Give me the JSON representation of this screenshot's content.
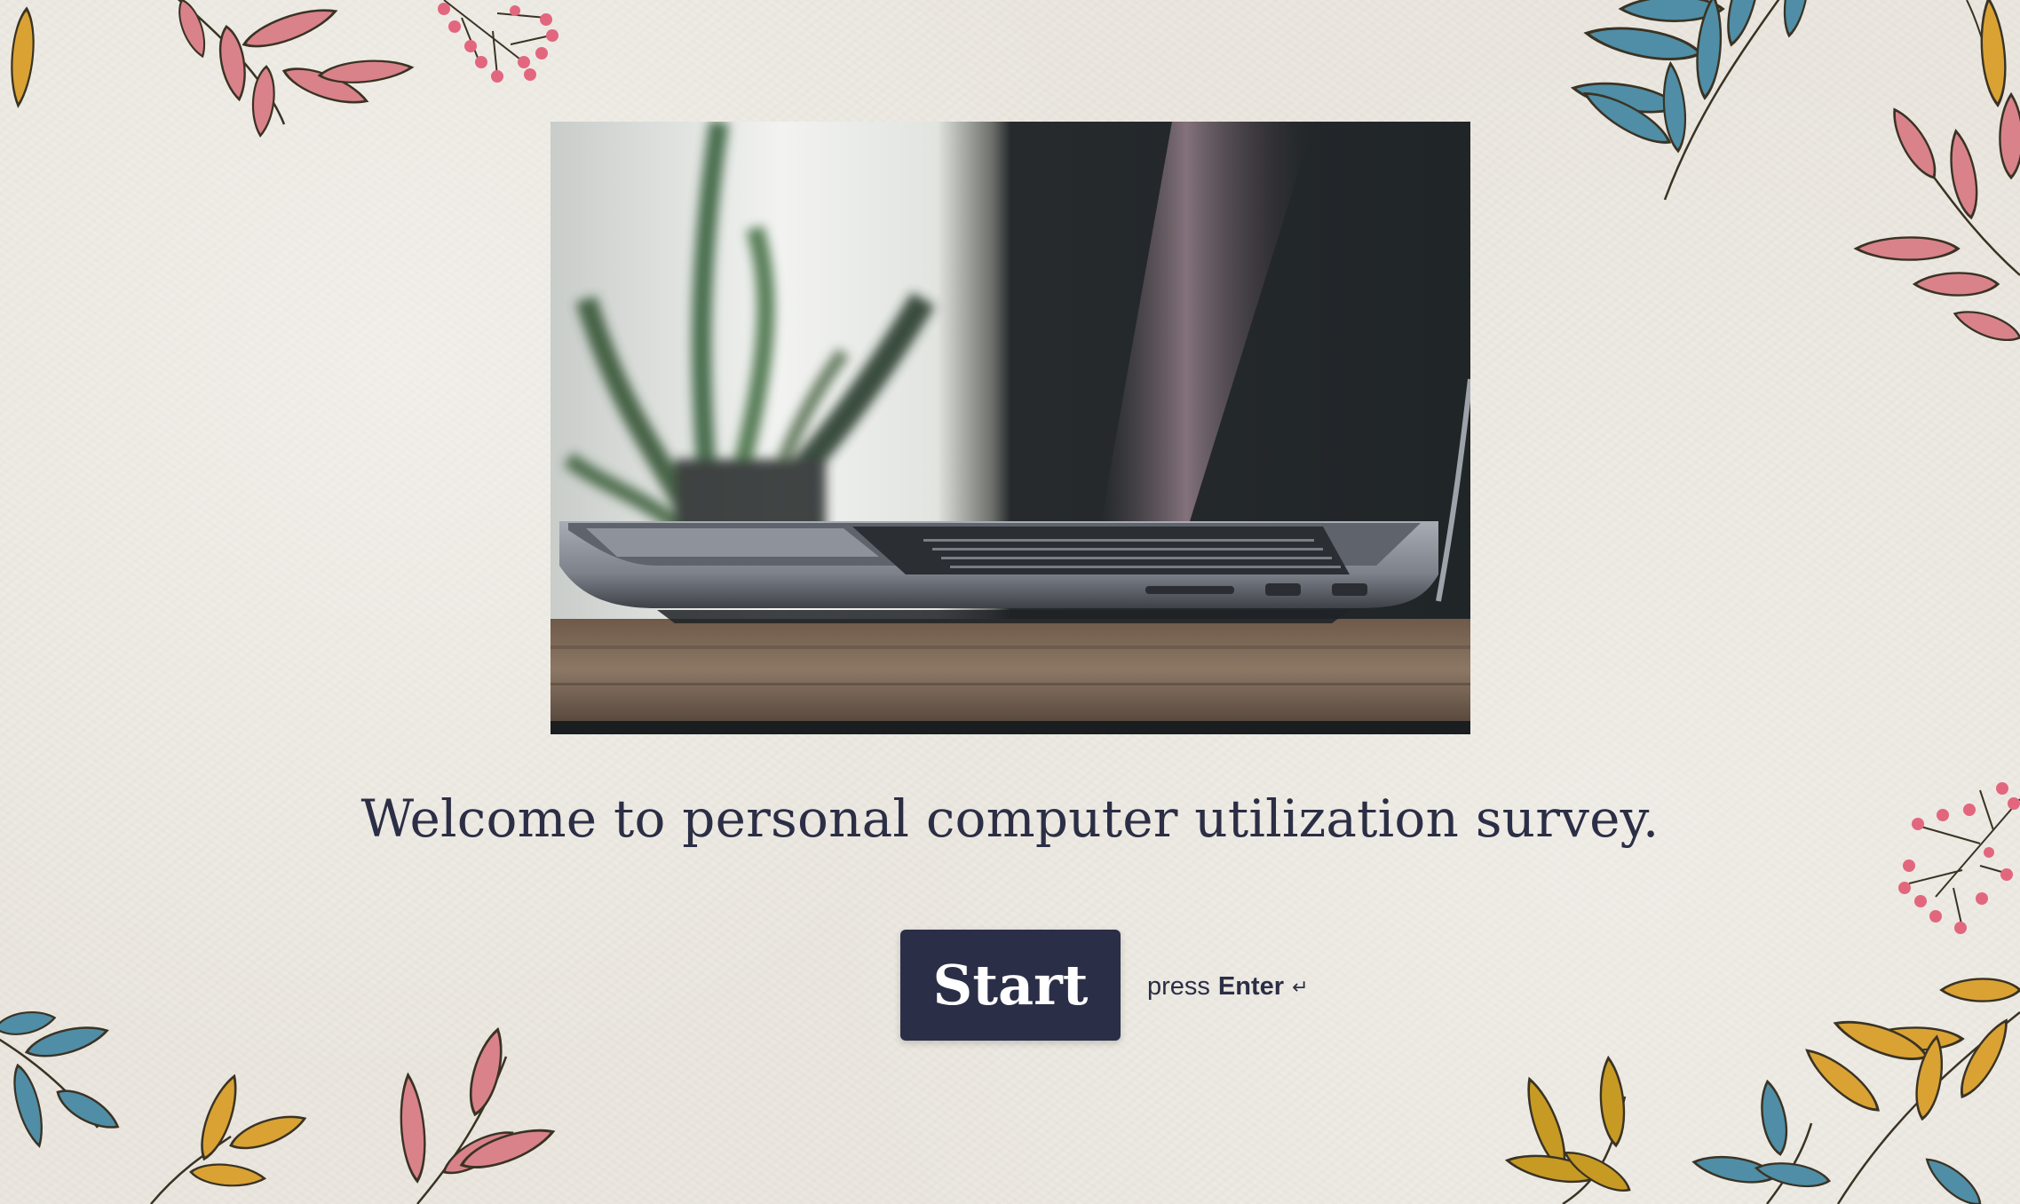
{
  "welcome": {
    "title": "Welcome to personal computer utilization survey."
  },
  "start": {
    "label": "Start"
  },
  "hint": {
    "prefix": "press",
    "key": "Enter",
    "icon": "↵"
  },
  "hero_image": {
    "subject": "laptop-on-wooden-desk-with-plant",
    "alt": ""
  },
  "colors": {
    "background": "#ebe7df",
    "accent": "#2b2e47",
    "text": "#2b2e45",
    "leaf_teal": "#4f8ea6",
    "leaf_pink": "#d9828a",
    "leaf_gold": "#d9a233",
    "berry_pink": "#e2677e"
  }
}
